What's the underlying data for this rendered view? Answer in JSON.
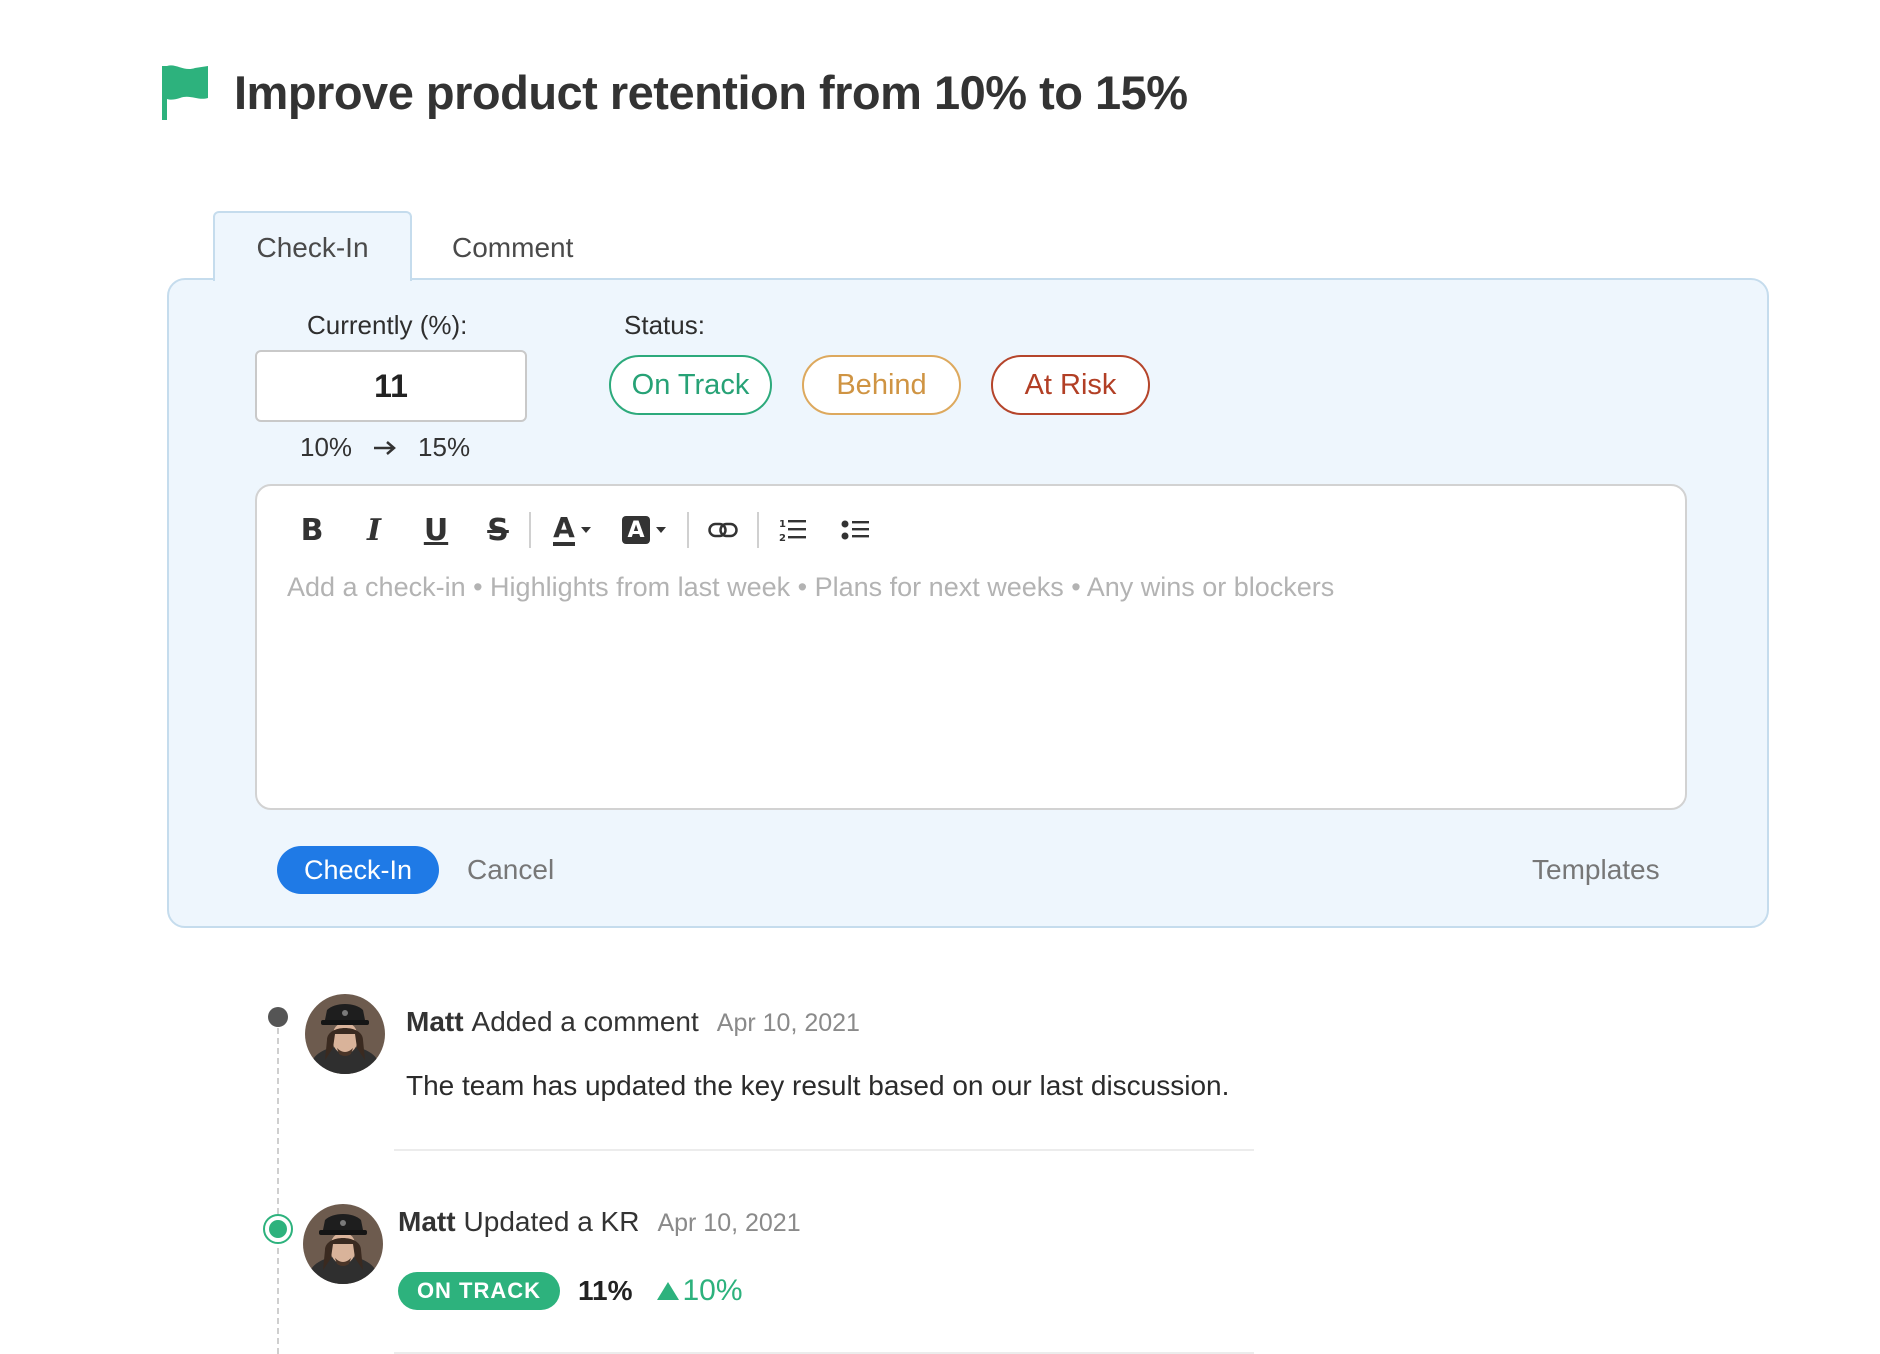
{
  "header": {
    "title": "Improve product retention from 10% to 15%",
    "flag_color": "#2db27d"
  },
  "tabs": [
    {
      "label": "Check-In",
      "active": true
    },
    {
      "label": "Comment",
      "active": false
    }
  ],
  "checkin": {
    "current_label": "Currently (%):",
    "current_value": "11",
    "range_start": "10%",
    "range_end": "15%",
    "status_label": "Status:",
    "status_options": {
      "on_track": "On Track",
      "behind": "Behind",
      "at_risk": "At Risk"
    },
    "status_colors": {
      "on_track": "#27a276",
      "behind": "#cf9443",
      "at_risk": "#b23f25"
    },
    "toolbar": {
      "bold": "B",
      "italic": "I",
      "underline": "U",
      "strike": "S",
      "text_color": "A",
      "highlight": "A",
      "icons": [
        "link-icon",
        "ordered-list-icon",
        "bullet-list-icon"
      ]
    },
    "editor_placeholder": "Add a check-in • Highlights from last week • Plans for next weeks • Any wins or blockers",
    "submit_label": "Check-In",
    "cancel_label": "Cancel",
    "templates_label": "Templates",
    "accent": "#1f7ae6"
  },
  "timeline": [
    {
      "author": "Matt",
      "action": "Added a comment",
      "date": "Apr 10, 2021",
      "body": "The team has updated the key result based on our last discussion."
    },
    {
      "author": "Matt",
      "action": "Updated a KR",
      "date": "Apr 10, 2021",
      "status_badge": "ON TRACK",
      "value": "11%",
      "delta": "10%"
    }
  ]
}
